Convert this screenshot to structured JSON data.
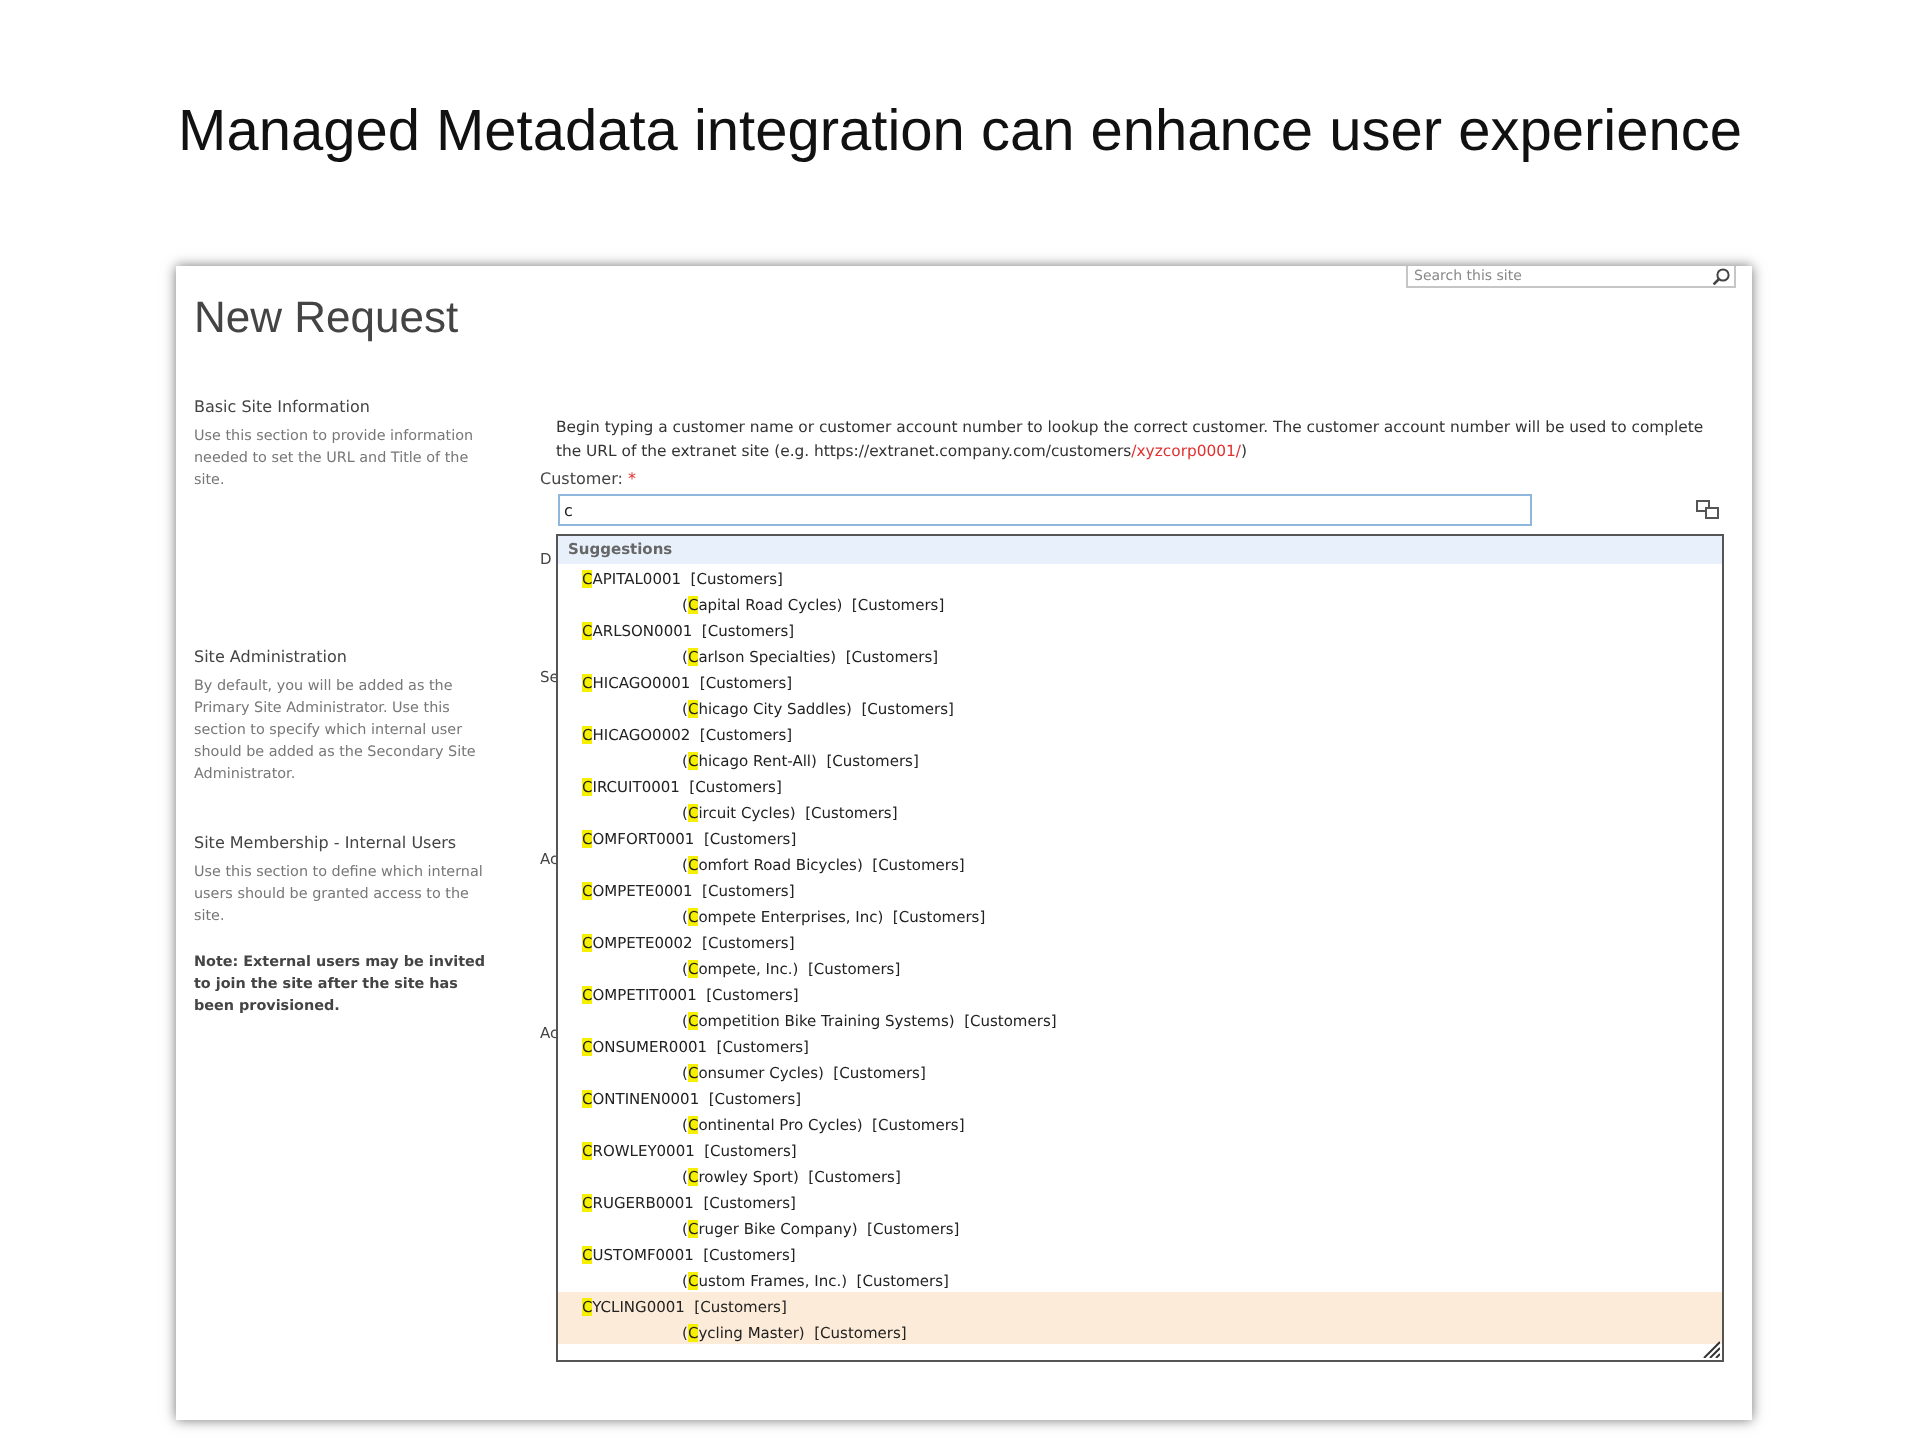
{
  "slide_title": "Managed Metadata integration can enhance user experience",
  "search": {
    "placeholder": "Search this site"
  },
  "page_title": "New Request",
  "sections": [
    {
      "heading": "Basic Site Information",
      "text": "Use this section to provide information needed to set the URL and Title of the site."
    },
    {
      "heading": "Site Administration",
      "text": "By default, you will be added as the Primary Site Administrator. Use this section to specify which internal user should be added as the Secondary Site Administrator."
    },
    {
      "heading": "Site Membership - Internal Users",
      "text": "Use this section to define which internal users should be granted access to the site.",
      "note": "Note: External users may be invited to join the site after the site has been provisioned."
    }
  ],
  "instructions": {
    "text": "Begin typing a customer name or customer account number to lookup the correct customer.  The customer account number will be used to complete the URL of the extranet site (e.g. https://extranet.company.com/customers",
    "highlight": "/xyzcorp0001/",
    "end": ")"
  },
  "customer": {
    "label": "Customer:",
    "required": "*",
    "value": "c"
  },
  "hidden_labels": [
    "D",
    "Se",
    "Ac",
    "Ac"
  ],
  "suggestions": {
    "header": "Suggestions",
    "items": [
      {
        "code": "CAPITAL0001",
        "term_set": "[Customers]",
        "name": "(Capital Road Cycles)",
        "name_set": "[Customers]",
        "selected": false
      },
      {
        "code": "CARLSON0001",
        "term_set": "[Customers]",
        "name": "(Carlson Specialties)",
        "name_set": "[Customers]",
        "selected": false
      },
      {
        "code": "CHICAGO0001",
        "term_set": "[Customers]",
        "name": "(Chicago City Saddles)",
        "name_set": "[Customers]",
        "selected": false
      },
      {
        "code": "CHICAGO0002",
        "term_set": "[Customers]",
        "name": "(Chicago Rent-All)",
        "name_set": "[Customers]",
        "selected": false
      },
      {
        "code": "CIRCUIT0001",
        "term_set": "[Customers]",
        "name": "(Circuit Cycles)",
        "name_set": "[Customers]",
        "selected": false
      },
      {
        "code": "COMFORT0001",
        "term_set": "[Customers]",
        "name": "(Comfort Road Bicycles)",
        "name_set": "[Customers]",
        "selected": false
      },
      {
        "code": "COMPETE0001",
        "term_set": "[Customers]",
        "name": "(Compete Enterprises, Inc)",
        "name_set": "[Customers]",
        "selected": false
      },
      {
        "code": "COMPETE0002",
        "term_set": "[Customers]",
        "name": "(Compete, Inc.)",
        "name_set": "[Customers]",
        "selected": false
      },
      {
        "code": "COMPETIT0001",
        "term_set": "[Customers]",
        "name": "(Competition Bike Training Systems)",
        "name_set": "[Customers]",
        "selected": false
      },
      {
        "code": "CONSUMER0001",
        "term_set": "[Customers]",
        "name": "(Consumer Cycles)",
        "name_set": "[Customers]",
        "selected": false
      },
      {
        "code": "CONTINEN0001",
        "term_set": "[Customers]",
        "name": "(Continental Pro Cycles)",
        "name_set": "[Customers]",
        "selected": false
      },
      {
        "code": "CROWLEY0001",
        "term_set": "[Customers]",
        "name": "(Crowley Sport)",
        "name_set": "[Customers]",
        "selected": false
      },
      {
        "code": "CRUGERB0001",
        "term_set": "[Customers]",
        "name": "(Cruger Bike Company)",
        "name_set": "[Customers]",
        "selected": false
      },
      {
        "code": "CUSTOMF0001",
        "term_set": "[Customers]",
        "name": "(Custom Frames, Inc.)",
        "name_set": "[Customers]",
        "selected": false
      },
      {
        "code": "CYCLING0001",
        "term_set": "[Customers]",
        "name": "(Cycling Master)",
        "name_set": "[Customers]",
        "selected": true
      }
    ]
  }
}
